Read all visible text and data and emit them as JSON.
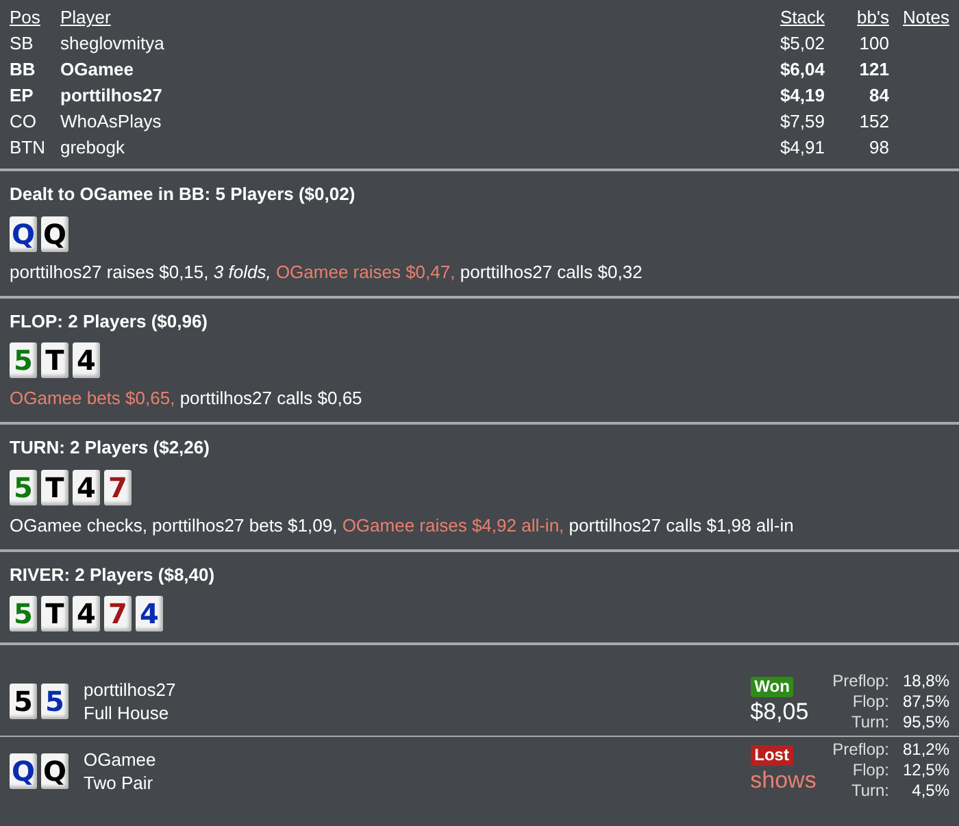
{
  "table": {
    "columns": [
      "Pos",
      "Player",
      "Stack",
      "bb's",
      "Notes"
    ],
    "rows": [
      {
        "pos": "SB",
        "player": "sheglovmitya",
        "stack": "$5,02",
        "bbs": "100",
        "highlighted": false
      },
      {
        "pos": "BB",
        "player": "OGamee",
        "stack": "$6,04",
        "bbs": "121",
        "highlighted": true
      },
      {
        "pos": "EP",
        "player": "porttilhos27",
        "stack": "$4,19",
        "bbs": "84",
        "highlighted": true
      },
      {
        "pos": "CO",
        "player": "WhoAsPlays",
        "stack": "$7,59",
        "bbs": "152",
        "highlighted": false
      },
      {
        "pos": "BTN",
        "player": "grebogk",
        "stack": "$4,91",
        "bbs": "98",
        "highlighted": false
      }
    ]
  },
  "streets": [
    {
      "title": "Dealt to OGamee in BB: 5 Players ($0,02)",
      "cards": [
        {
          "rank": "Q",
          "color": "#0a2db0"
        },
        {
          "rank": "Q",
          "color": "#000000"
        }
      ],
      "actions": [
        {
          "text": "porttilhos27 raises $0,15,",
          "kind": "normal"
        },
        {
          "text": "3 folds,",
          "kind": "folds"
        },
        {
          "text": "OGamee raises $0,47,",
          "kind": "hero"
        },
        {
          "text": "porttilhos27 calls $0,32",
          "kind": "normal"
        }
      ]
    },
    {
      "title": "FLOP: 2 Players ($0,96)",
      "cards": [
        {
          "rank": "5",
          "color": "#0f7a0f"
        },
        {
          "rank": "T",
          "color": "#000000"
        },
        {
          "rank": "4",
          "color": "#000000"
        }
      ],
      "actions": [
        {
          "text": "OGamee bets $0,65,",
          "kind": "hero"
        },
        {
          "text": "porttilhos27 calls $0,65",
          "kind": "normal"
        }
      ]
    },
    {
      "title": "TURN: 2 Players ($2,26)",
      "cards": [
        {
          "rank": "5",
          "color": "#0f7a0f"
        },
        {
          "rank": "T",
          "color": "#000000"
        },
        {
          "rank": "4",
          "color": "#000000"
        },
        {
          "rank": "7",
          "color": "#a01818"
        }
      ],
      "actions": [
        {
          "text": "OGamee checks, porttilhos27 bets $1,09,",
          "kind": "normal"
        },
        {
          "text": "OGamee raises $4,92 all-in,",
          "kind": "hero"
        },
        {
          "text": "porttilhos27 calls $1,98 all-in",
          "kind": "normal"
        }
      ]
    },
    {
      "title": "RIVER: 2 Players ($8,40)",
      "cards": [
        {
          "rank": "5",
          "color": "#0f7a0f"
        },
        {
          "rank": "T",
          "color": "#000000"
        },
        {
          "rank": "4",
          "color": "#000000"
        },
        {
          "rank": "7",
          "color": "#a01818"
        },
        {
          "rank": "4",
          "color": "#0a2db0"
        }
      ]
    }
  ],
  "results": [
    {
      "cards": [
        {
          "rank": "5",
          "color": "#000000"
        },
        {
          "rank": "5",
          "color": "#0a2db0"
        }
      ],
      "player": "porttilhos27",
      "hand": "Full House",
      "won": true,
      "badge": "Won",
      "amount": "$8,05",
      "equity": [
        {
          "label": "Preflop:",
          "value": "18,8%"
        },
        {
          "label": "Flop:",
          "value": "87,5%"
        },
        {
          "label": "Turn:",
          "value": "95,5%"
        }
      ]
    },
    {
      "cards": [
        {
          "rank": "Q",
          "color": "#0a2db0"
        },
        {
          "rank": "Q",
          "color": "#000000"
        }
      ],
      "player": "OGamee",
      "hand": "Two Pair",
      "won": false,
      "badge": "Lost",
      "amount": "shows",
      "equity": [
        {
          "label": "Preflop:",
          "value": "81,2%"
        },
        {
          "label": "Flop:",
          "value": "12,5%"
        },
        {
          "label": "Turn:",
          "value": "4,5%"
        }
      ]
    }
  ]
}
